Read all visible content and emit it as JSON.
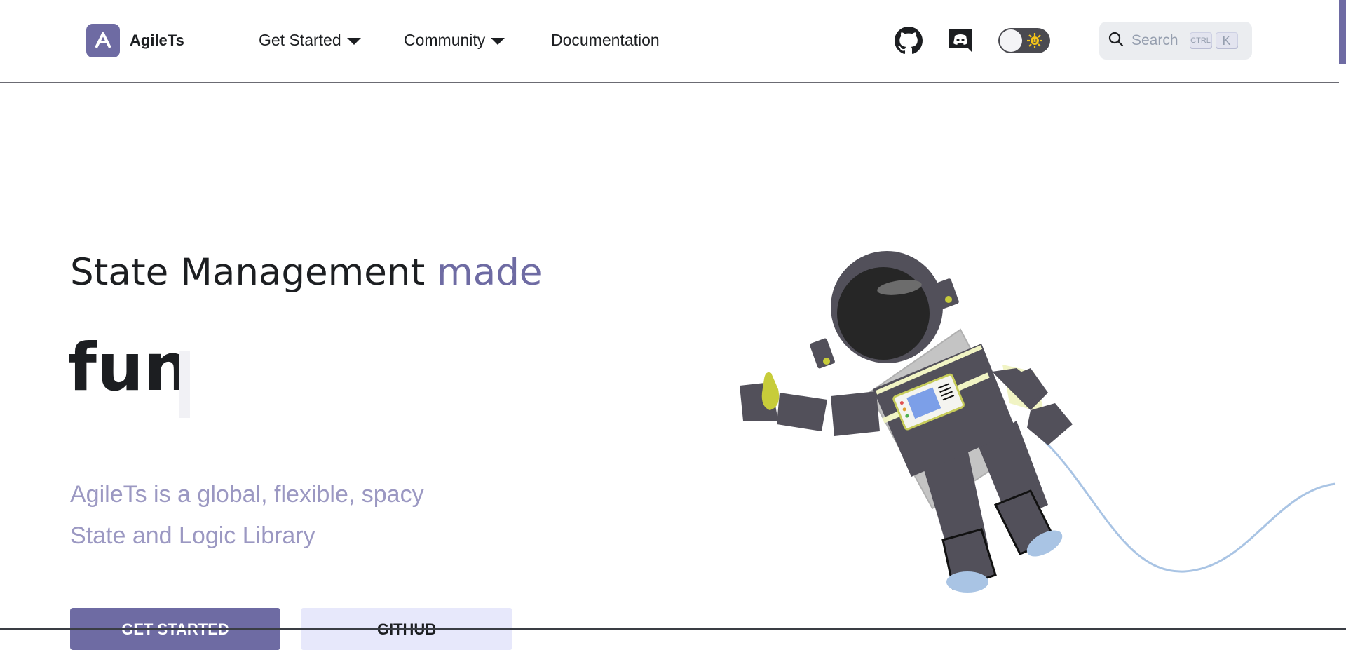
{
  "navbar": {
    "brand": "AgileTs",
    "items": [
      {
        "label": "Get Started",
        "dropdown": true
      },
      {
        "label": "Community",
        "dropdown": true
      },
      {
        "label": "Documentation",
        "dropdown": false
      }
    ],
    "icons": [
      "github-icon",
      "discord-icon"
    ],
    "theme_toggle": {
      "state": "light",
      "icon": "sun-icon"
    },
    "search": {
      "label": "Search",
      "shortcut": [
        "CTRL",
        "K"
      ]
    }
  },
  "hero": {
    "title_prefix": "State Management",
    "title_accent": "made",
    "animated_word": "fun",
    "description": "AgileTs is a global, flexible, spacy State and Logic Library",
    "buttons": {
      "primary": "GET STARTED",
      "secondary": "GITHUB"
    }
  },
  "colors": {
    "accent": "#6e6ba3",
    "description": "#9b98c2",
    "search_bg": "#ebedf0"
  }
}
